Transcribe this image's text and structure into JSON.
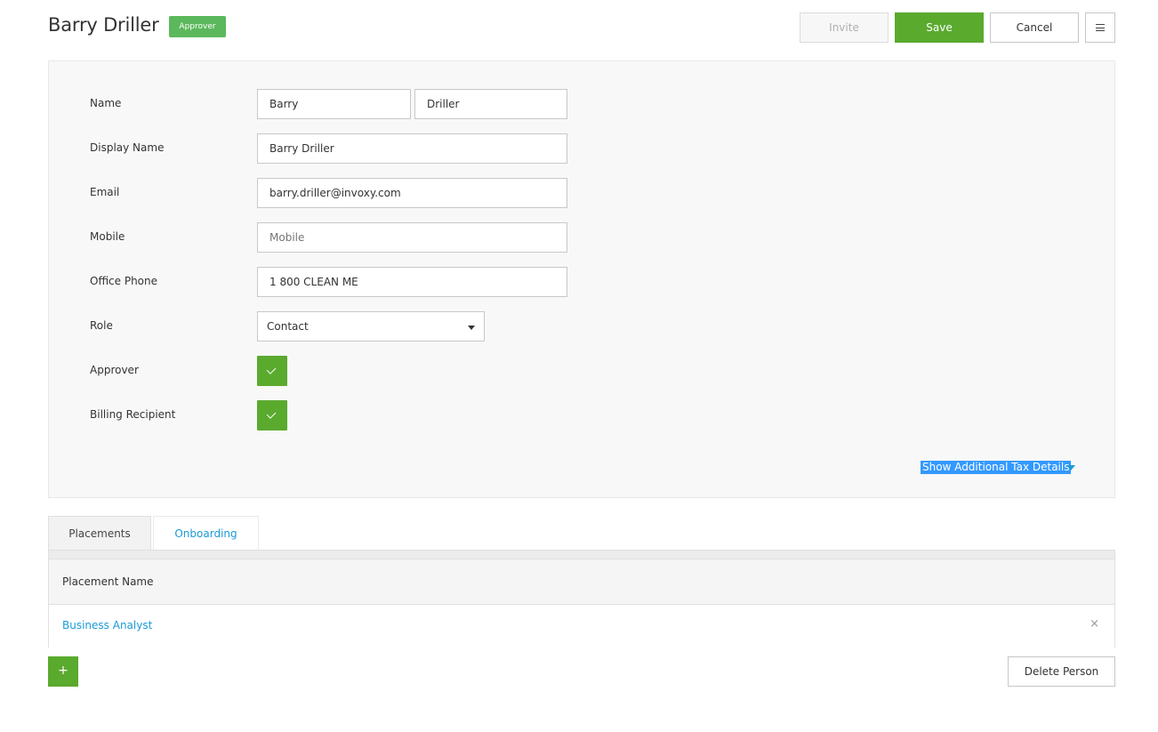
{
  "header": {
    "title": "Barry Driller",
    "badge": "Approver",
    "invite_label": "Invite",
    "save_label": "Save",
    "cancel_label": "Cancel",
    "menu_icon": "hamburger-icon"
  },
  "form": {
    "name_label": "Name",
    "first_name": "Barry",
    "last_name": "Driller",
    "display_name_label": "Display Name",
    "display_name": "Barry Driller",
    "email_label": "Email",
    "email": "barry.driller@invoxy.com",
    "mobile_label": "Mobile",
    "mobile_placeholder": "Mobile",
    "office_phone_label": "Office Phone",
    "office_phone": "1 800 CLEAN ME",
    "role_label": "Role",
    "role_value": "Contact",
    "approver_label": "Approver",
    "approver_checked": true,
    "billing_recipient_label": "Billing Recipient",
    "billing_recipient_checked": true,
    "tax_link": "Show Additional Tax Details"
  },
  "tabs": [
    {
      "label": "Placements",
      "active": true
    },
    {
      "label": "Onboarding",
      "active": false
    }
  ],
  "table": {
    "header": "Placement Name",
    "rows": [
      {
        "name": "Business Analyst"
      }
    ],
    "remove_glyph": "×"
  },
  "footer": {
    "add_glyph": "+",
    "delete_label": "Delete Person"
  },
  "colors": {
    "primary_green": "#5aaa2e",
    "badge_green": "#5cb85c",
    "link_blue": "#1a9bd7",
    "selection_blue": "#3399ff"
  }
}
